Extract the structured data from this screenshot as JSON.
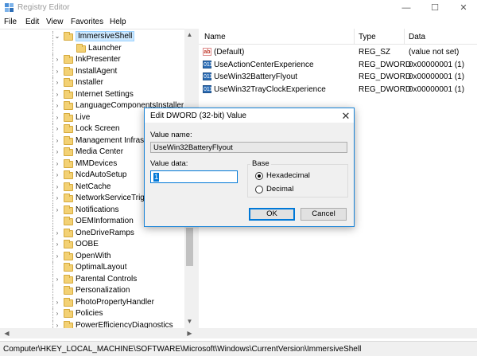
{
  "window": {
    "title": "Registry Editor",
    "controls": {
      "minimize": "—",
      "maximize": "☐",
      "close": "✕"
    }
  },
  "menu": [
    "File",
    "Edit",
    "View",
    "Favorites",
    "Help"
  ],
  "tree": {
    "items": [
      {
        "label": "ImmersiveShell",
        "expander": "⌄",
        "level": 0,
        "selected": true
      },
      {
        "label": "Launcher",
        "expander": "",
        "level": 1,
        "selected": false
      },
      {
        "label": "InkPresenter",
        "expander": "›",
        "level": 0,
        "selected": false
      },
      {
        "label": "InstallAgent",
        "expander": "›",
        "level": 0,
        "selected": false
      },
      {
        "label": "Installer",
        "expander": "›",
        "level": 0,
        "selected": false
      },
      {
        "label": "Internet Settings",
        "expander": "›",
        "level": 0,
        "selected": false
      },
      {
        "label": "LanguageComponentsInstaller",
        "expander": "›",
        "level": 0,
        "selected": false
      },
      {
        "label": "Live",
        "expander": "›",
        "level": 0,
        "selected": false
      },
      {
        "label": "Lock Screen",
        "expander": "›",
        "level": 0,
        "selected": false
      },
      {
        "label": "Management Infrast",
        "expander": "›",
        "level": 0,
        "selected": false
      },
      {
        "label": "Media Center",
        "expander": "›",
        "level": 0,
        "selected": false
      },
      {
        "label": "MMDevices",
        "expander": "›",
        "level": 0,
        "selected": false
      },
      {
        "label": "NcdAutoSetup",
        "expander": "›",
        "level": 0,
        "selected": false
      },
      {
        "label": "NetCache",
        "expander": "›",
        "level": 0,
        "selected": false
      },
      {
        "label": "NetworkServiceTrigg",
        "expander": "›",
        "level": 0,
        "selected": false
      },
      {
        "label": "Notifications",
        "expander": "›",
        "level": 0,
        "selected": false
      },
      {
        "label": "OEMInformation",
        "expander": "",
        "level": 0,
        "selected": false
      },
      {
        "label": "OneDriveRamps",
        "expander": "›",
        "level": 0,
        "selected": false
      },
      {
        "label": "OOBE",
        "expander": "›",
        "level": 0,
        "selected": false
      },
      {
        "label": "OpenWith",
        "expander": "›",
        "level": 0,
        "selected": false
      },
      {
        "label": "OptimalLayout",
        "expander": "",
        "level": 0,
        "selected": false
      },
      {
        "label": "Parental Controls",
        "expander": "›",
        "level": 0,
        "selected": false
      },
      {
        "label": "Personalization",
        "expander": "",
        "level": 0,
        "selected": false
      },
      {
        "label": "PhotoPropertyHandler",
        "expander": "›",
        "level": 0,
        "selected": false
      },
      {
        "label": "Policies",
        "expander": "›",
        "level": 0,
        "selected": false
      },
      {
        "label": "PowerEfficiencyDiagnostics",
        "expander": "›",
        "level": 0,
        "selected": false
      }
    ]
  },
  "list": {
    "columns": [
      "Name",
      "Type",
      "Data"
    ],
    "rows": [
      {
        "icon": "string-value-icon",
        "icon_text": "ab",
        "name": "(Default)",
        "type": "REG_SZ",
        "data": "(value not set)"
      },
      {
        "icon": "dword-value-icon",
        "icon_text": "011",
        "name": "UseActionCenterExperience",
        "type": "REG_DWORD",
        "data": "0x00000001 (1)"
      },
      {
        "icon": "dword-value-icon",
        "icon_text": "011",
        "name": "UseWin32BatteryFlyout",
        "type": "REG_DWORD",
        "data": "0x00000001 (1)"
      },
      {
        "icon": "dword-value-icon",
        "icon_text": "011",
        "name": "UseWin32TrayClockExperience",
        "type": "REG_DWORD",
        "data": "0x00000001 (1)"
      }
    ]
  },
  "status": {
    "path": "Computer\\HKEY_LOCAL_MACHINE\\SOFTWARE\\Microsoft\\Windows\\CurrentVersion\\ImmersiveShell"
  },
  "dialog": {
    "title": "Edit DWORD (32-bit) Value",
    "close": "✕",
    "value_name_label": "Value name:",
    "value_name": "UseWin32BatteryFlyout",
    "value_data_label": "Value data:",
    "value_data": "1",
    "base_label": "Base",
    "hex_label": "Hexadecimal",
    "dec_label": "Decimal",
    "selected_base": "Hexadecimal",
    "ok_label": "OK",
    "cancel_label": "Cancel"
  },
  "colors": {
    "accent": "#0078d7",
    "selection": "#cce8ff",
    "folder": "#f3d174"
  }
}
